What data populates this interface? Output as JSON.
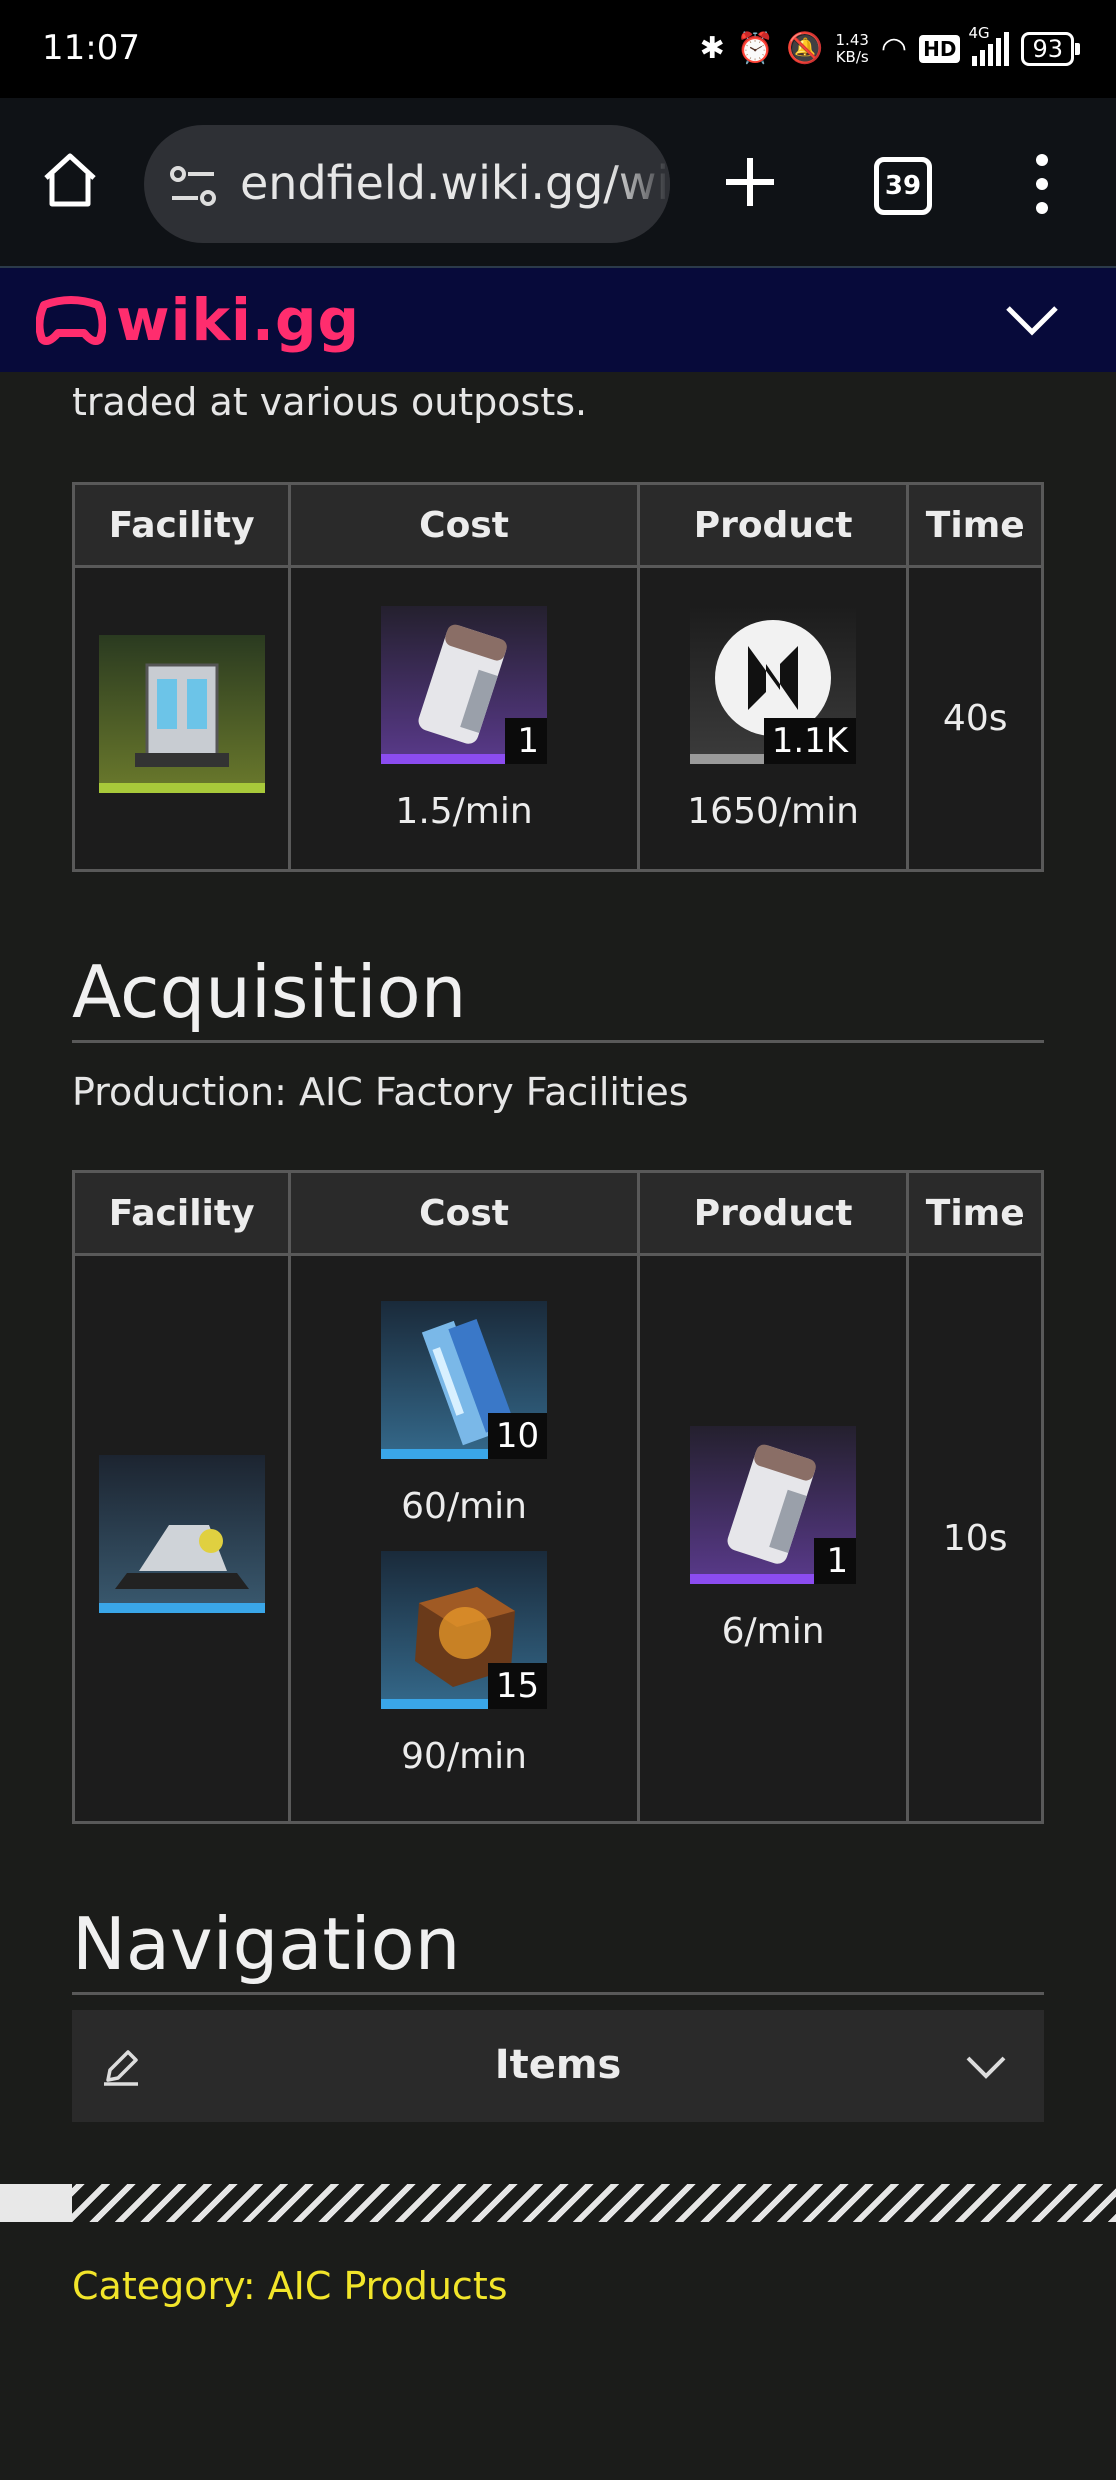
{
  "status_bar": {
    "time": "11:07",
    "net_speed": "1.43\nKB/s",
    "hd": "HD",
    "network": "4G",
    "battery": "93"
  },
  "browser": {
    "url": "endfield.wiki.gg/wiki",
    "tab_count": "39"
  },
  "wiki": {
    "logo_text": "wiki.gg"
  },
  "intro_text": "traded at various outposts.",
  "table1": {
    "headers": [
      "Facility",
      "Cost",
      "Product",
      "Time"
    ],
    "cost_qty": "1",
    "cost_rate": "1.5/min",
    "product_qty": "1.1K",
    "product_rate": "1650/min",
    "time": "40s"
  },
  "acquisition": {
    "heading": "Acquisition",
    "subline": "Production: AIC Factory Facilities"
  },
  "table2": {
    "headers": [
      "Facility",
      "Cost",
      "Product",
      "Time"
    ],
    "cost1_qty": "10",
    "cost1_rate": "60/min",
    "cost2_qty": "15",
    "cost2_rate": "90/min",
    "product_qty": "1",
    "product_rate": "6/min",
    "time": "10s"
  },
  "navigation": {
    "heading": "Navigation",
    "box_title": "Items"
  },
  "category": {
    "label": "Category:",
    "link": "AIC Products"
  },
  "colors": {
    "accent_pink": "#ff2d6e",
    "wiki_bar": "#070a3a",
    "category_yellow": "#f2e52a",
    "rarity_purple": "#8b4cf0",
    "rarity_blue": "#3aa6e8",
    "rarity_green": "#a8c93a",
    "rarity_gray": "#9a9a9a"
  }
}
